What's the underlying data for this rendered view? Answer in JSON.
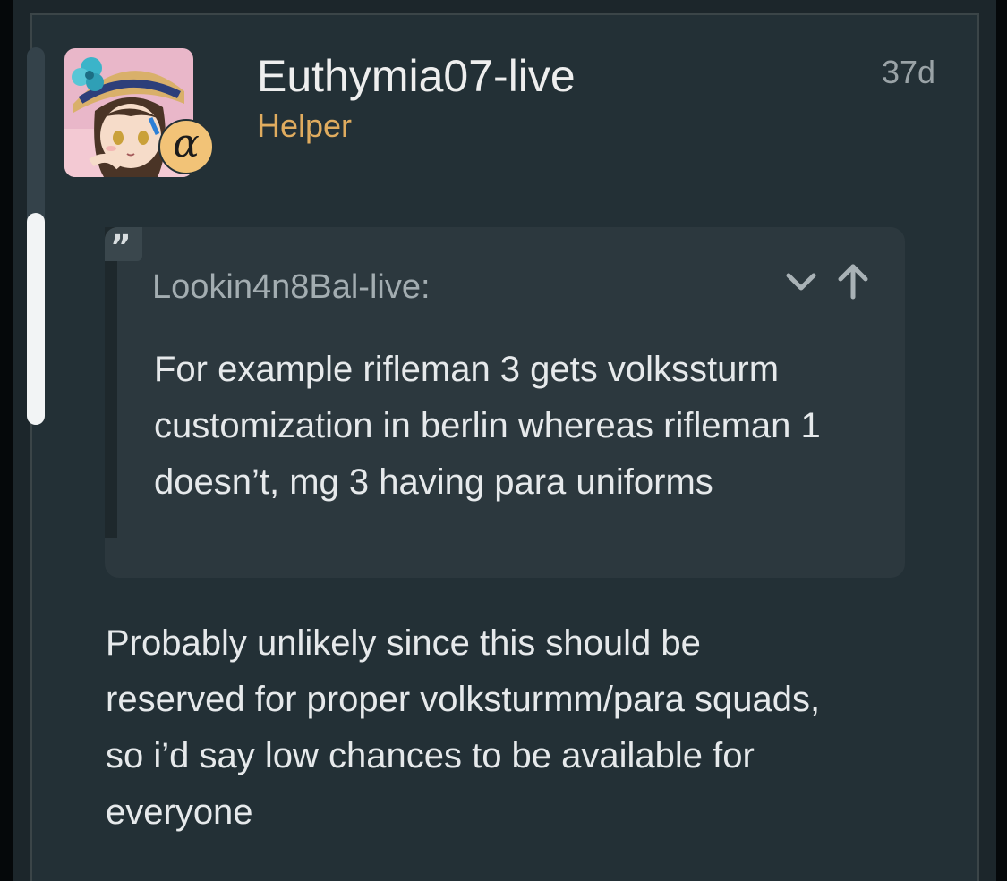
{
  "post": {
    "username": "Euthymia07-live",
    "user_title": "Helper",
    "age": "37d",
    "avatar_icon": "anime-avatar-image",
    "badge_glyph": "α",
    "badge_color": "#f2c377"
  },
  "quote": {
    "author": "Lookin4n8Bal-live:",
    "text": "For example rifleman 3 gets volkssturm customization in berlin whereas rifleman 1 doesn’t, mg 3 having para uniforms",
    "expand_icon": "chevron-down-icon",
    "jump_icon": "arrow-up-icon"
  },
  "body": {
    "text": "Probably unlikely since this should be reserved for proper volksturmm/para squads, so i’d say low chances to be available for everyone"
  },
  "colors": {
    "background": "#1c262b",
    "card": "#233036",
    "quote_bg": "#2c383e",
    "accent": "#e0ac5f"
  }
}
